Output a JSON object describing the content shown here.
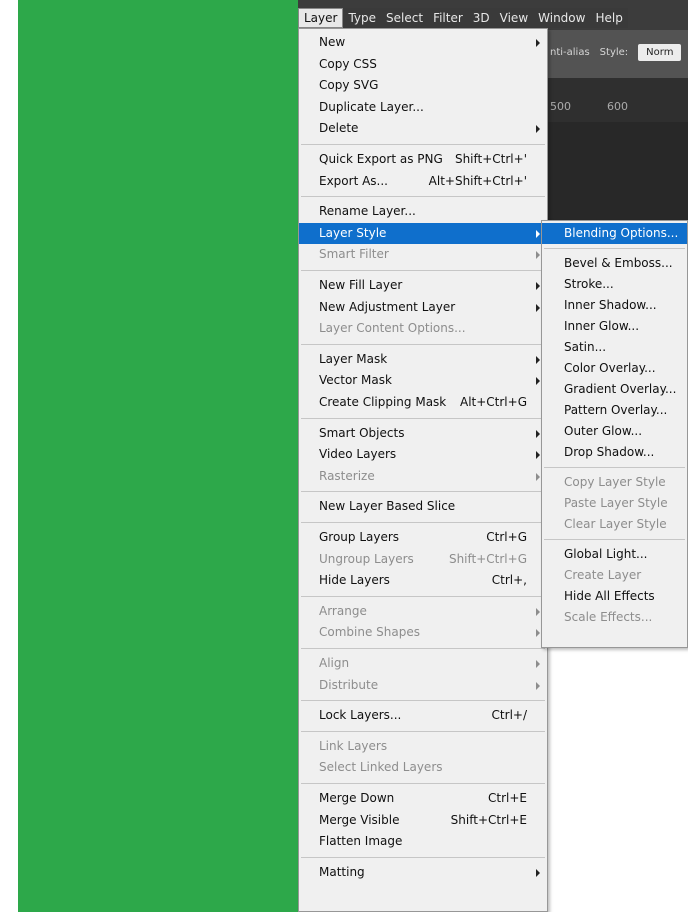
{
  "menubar": [
    {
      "label": "Layer",
      "active": true
    },
    {
      "label": "Type"
    },
    {
      "label": "Select"
    },
    {
      "label": "Filter"
    },
    {
      "label": "3D"
    },
    {
      "label": "View"
    },
    {
      "label": "Window"
    },
    {
      "label": "Help"
    }
  ],
  "options_bar": {
    "anti_alias": "nti-alias",
    "style_label": "Style:",
    "style_value": "Norm"
  },
  "ruler_ticks": [
    "500",
    "600"
  ],
  "layer_menu": [
    {
      "label": "New",
      "sub": true
    },
    {
      "label": "Copy CSS"
    },
    {
      "label": "Copy SVG"
    },
    {
      "label": "Duplicate Layer..."
    },
    {
      "label": "Delete",
      "sub": true
    },
    {
      "sep": true
    },
    {
      "label": "Quick Export as PNG",
      "shortcut": "Shift+Ctrl+'"
    },
    {
      "label": "Export As...",
      "shortcut": "Alt+Shift+Ctrl+'"
    },
    {
      "sep": true
    },
    {
      "label": "Rename Layer..."
    },
    {
      "label": "Layer Style",
      "sub": true,
      "highlighted": true
    },
    {
      "label": "Smart Filter",
      "sub": true,
      "disabled": true
    },
    {
      "sep": true
    },
    {
      "label": "New Fill Layer",
      "sub": true
    },
    {
      "label": "New Adjustment Layer",
      "sub": true
    },
    {
      "label": "Layer Content Options...",
      "disabled": true
    },
    {
      "sep": true
    },
    {
      "label": "Layer Mask",
      "sub": true
    },
    {
      "label": "Vector Mask",
      "sub": true
    },
    {
      "label": "Create Clipping Mask",
      "shortcut": "Alt+Ctrl+G"
    },
    {
      "sep": true
    },
    {
      "label": "Smart Objects",
      "sub": true
    },
    {
      "label": "Video Layers",
      "sub": true
    },
    {
      "label": "Rasterize",
      "sub": true,
      "disabled": true
    },
    {
      "sep": true
    },
    {
      "label": "New Layer Based Slice"
    },
    {
      "sep": true
    },
    {
      "label": "Group Layers",
      "shortcut": "Ctrl+G"
    },
    {
      "label": "Ungroup Layers",
      "shortcut": "Shift+Ctrl+G",
      "disabled": true
    },
    {
      "label": "Hide Layers",
      "shortcut": "Ctrl+,"
    },
    {
      "sep": true
    },
    {
      "label": "Arrange",
      "sub": true,
      "disabled": true
    },
    {
      "label": "Combine Shapes",
      "sub": true,
      "disabled": true
    },
    {
      "sep": true
    },
    {
      "label": "Align",
      "sub": true,
      "disabled": true
    },
    {
      "label": "Distribute",
      "sub": true,
      "disabled": true
    },
    {
      "sep": true
    },
    {
      "label": "Lock Layers...",
      "shortcut": "Ctrl+/"
    },
    {
      "sep": true
    },
    {
      "label": "Link Layers",
      "disabled": true
    },
    {
      "label": "Select Linked Layers",
      "disabled": true
    },
    {
      "sep": true
    },
    {
      "label": "Merge Down",
      "shortcut": "Ctrl+E"
    },
    {
      "label": "Merge Visible",
      "shortcut": "Shift+Ctrl+E"
    },
    {
      "label": "Flatten Image"
    },
    {
      "sep": true
    },
    {
      "label": "Matting",
      "sub": true
    }
  ],
  "style_submenu": [
    {
      "label": "Blending Options...",
      "highlighted": true
    },
    {
      "sep": true
    },
    {
      "label": "Bevel & Emboss..."
    },
    {
      "label": "Stroke..."
    },
    {
      "label": "Inner Shadow..."
    },
    {
      "label": "Inner Glow..."
    },
    {
      "label": "Satin..."
    },
    {
      "label": "Color Overlay..."
    },
    {
      "label": "Gradient Overlay..."
    },
    {
      "label": "Pattern Overlay..."
    },
    {
      "label": "Outer Glow..."
    },
    {
      "label": "Drop Shadow..."
    },
    {
      "sep": true
    },
    {
      "label": "Copy Layer Style",
      "disabled": true
    },
    {
      "label": "Paste Layer Style",
      "disabled": true
    },
    {
      "label": "Clear Layer Style",
      "disabled": true
    },
    {
      "sep": true
    },
    {
      "label": "Global Light..."
    },
    {
      "label": "Create Layer",
      "disabled": true
    },
    {
      "label": "Hide All Effects"
    },
    {
      "label": "Scale Effects...",
      "disabled": true
    }
  ],
  "colors": {
    "background_green": "#2da84a",
    "highlight": "#0f6fcc"
  }
}
